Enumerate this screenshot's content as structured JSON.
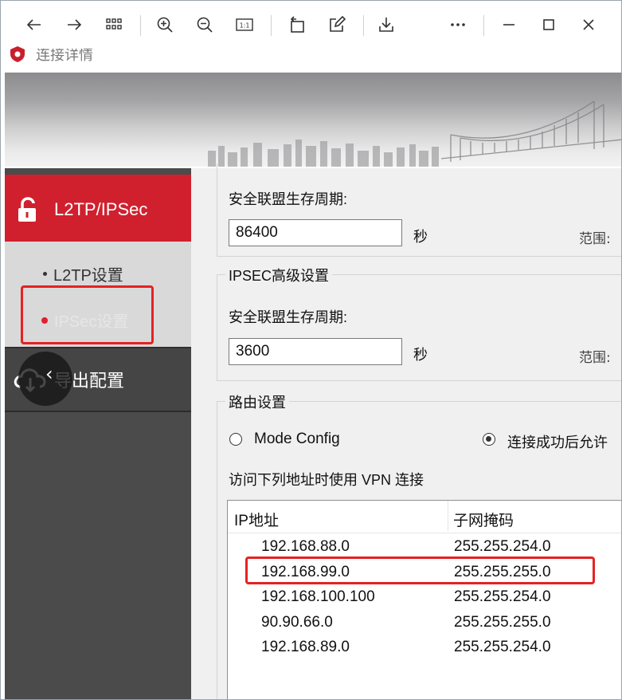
{
  "viewer": {
    "icons": [
      "back-arrow-icon",
      "forward-arrow-icon",
      "grid-icon",
      "zoom-in-icon",
      "zoom-out-icon",
      "actual-size-icon",
      "rotate-icon",
      "edit-icon",
      "download-icon",
      "more-icon",
      "minimize-icon",
      "maximize-icon",
      "close-icon"
    ],
    "actual_size_label": "1:1"
  },
  "app": {
    "title": "连接详情",
    "accent_color": "#d0202e"
  },
  "sidebar": {
    "header": "L2TP/IPSec",
    "items": [
      {
        "label": "L2TP设置",
        "active": false
      },
      {
        "label": "IPSec设置",
        "active": true
      }
    ],
    "export": "导出配置"
  },
  "main": {
    "sa_lifetime_label": "安全联盟生存周期:",
    "sa_lifetime_value": "86400",
    "unit_seconds": "秒",
    "range_label": "范围:",
    "ipsec_advanced": {
      "title": "IPSEC高级设置",
      "sa_lifetime_label": "安全联盟生存周期:",
      "sa_lifetime_value": "3600",
      "unit_seconds": "秒",
      "range_label": "范围:"
    },
    "routing": {
      "title": "路由设置",
      "option_mode_config": "Mode Config",
      "option_after_connect": "连接成功后允许",
      "selected": "option_after_connect",
      "access_label": "访问下列地址时使用 VPN 连接",
      "columns": [
        "IP地址",
        "子网掩码"
      ],
      "rows": [
        {
          "ip": "192.168.88.0",
          "mask": "255.255.254.0"
        },
        {
          "ip": "192.168.99.0",
          "mask": "255.255.255.0"
        },
        {
          "ip": "192.168.100.100",
          "mask": "255.255.254.0"
        },
        {
          "ip": "90.90.66.0",
          "mask": "255.255.255.0"
        },
        {
          "ip": "192.168.89.0",
          "mask": "255.255.254.0"
        }
      ]
    }
  },
  "annotations": {
    "highlight_color": "#e52222",
    "highlighted_sidebar_item": "IPSec设置",
    "highlighted_row_ip": "192.168.99.0"
  }
}
